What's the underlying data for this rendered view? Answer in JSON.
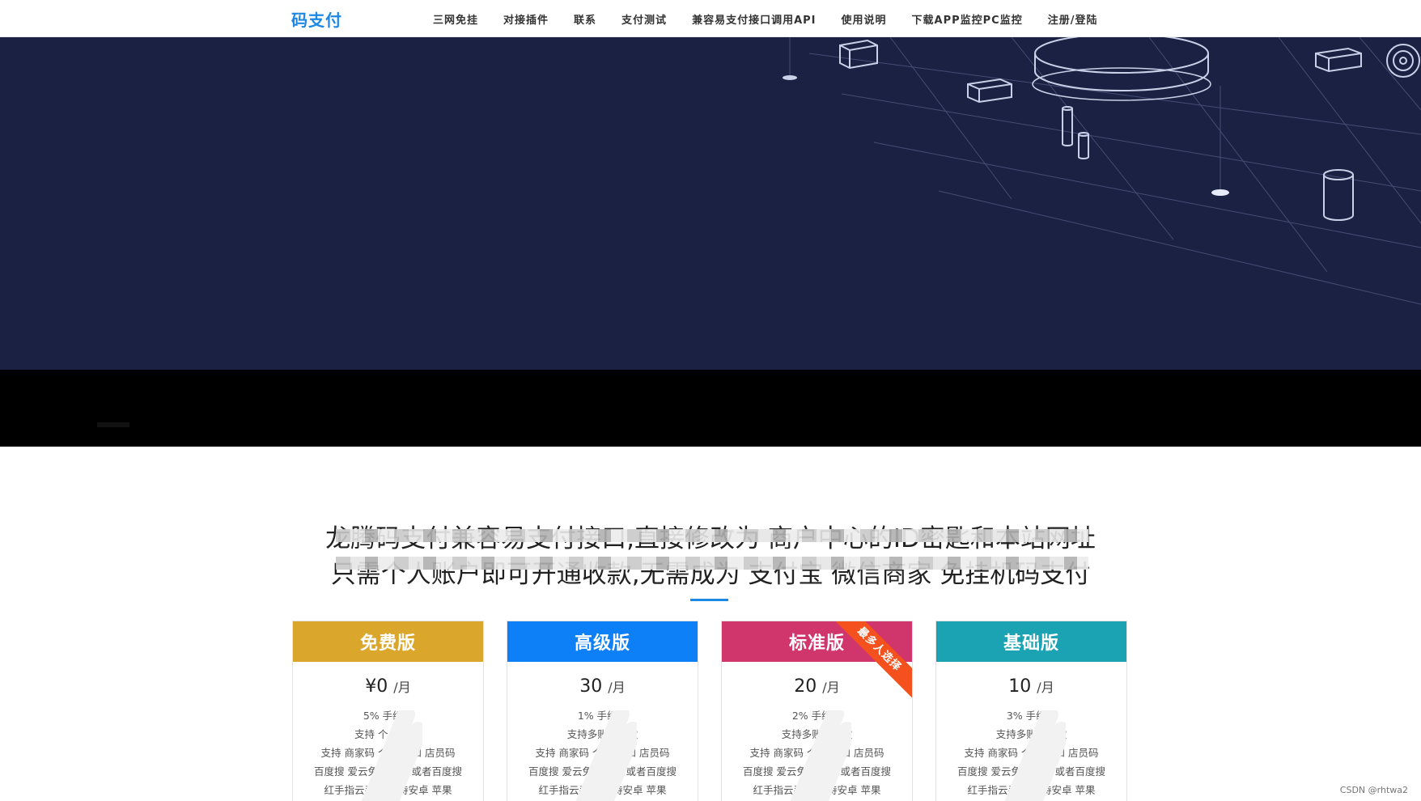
{
  "header": {
    "logo": "码支付",
    "nav": [
      {
        "label": "三网免挂"
      },
      {
        "label": "对接插件"
      },
      {
        "label": "联系"
      },
      {
        "label": "支付测试"
      },
      {
        "label": "兼容易支付接口调用API"
      },
      {
        "label": "使用说明"
      },
      {
        "label": "下载APP监控PC监控"
      },
      {
        "label": "注册/登陆"
      }
    ]
  },
  "intro": {
    "line1": "龙腾码支付兼容易支付接口,直接修改为 商户中心的ID密匙和本站网址",
    "line2": "只需个人账户即可开通收款,无需成为 支付宝 微信商家 免挂机码支付"
  },
  "plans": [
    {
      "name": "免费版",
      "color": "#dba62c",
      "price": "¥0",
      "unit": "/月",
      "features": [
        "5% 手续费",
        "支持 个人 收款",
        "支持 商家码 个人码 和 店员码",
        "百度搜 爱云免云手机 或者百度搜",
        "红手指云手机 支持安卓 苹果"
      ]
    },
    {
      "name": "高级版",
      "color": "#0d7ff7",
      "price": "30",
      "unit": "/月",
      "features": [
        "1% 手续费",
        "支持多账号收款",
        "支持 商家码 个人码 和 店员码",
        "百度搜 爱云免云手机 或者百度搜",
        "红手指云手机 支持安卓 苹果"
      ]
    },
    {
      "name": "标准版",
      "color": "#d0366b",
      "price": "20",
      "unit": "/月",
      "ribbon": "最多人选择",
      "features": [
        "2% 手续费",
        "支持多账号收款",
        "支持 商家码 个人码 和 店员码",
        "百度搜 爱云免云手机 或者百度搜",
        "红手指云手机 支持安卓 苹果"
      ]
    },
    {
      "name": "基础版",
      "color": "#1ba3b3",
      "price": "10",
      "unit": "/月",
      "features": [
        "3% 手续费",
        "支持多账号收款",
        "支持 商家码 个人码 和 店员码",
        "百度搜 爱云免云手机 或者百度搜",
        "红手指云手机 支持安卓 苹果"
      ]
    }
  ],
  "watermark": "CSDN @rhtwa2"
}
